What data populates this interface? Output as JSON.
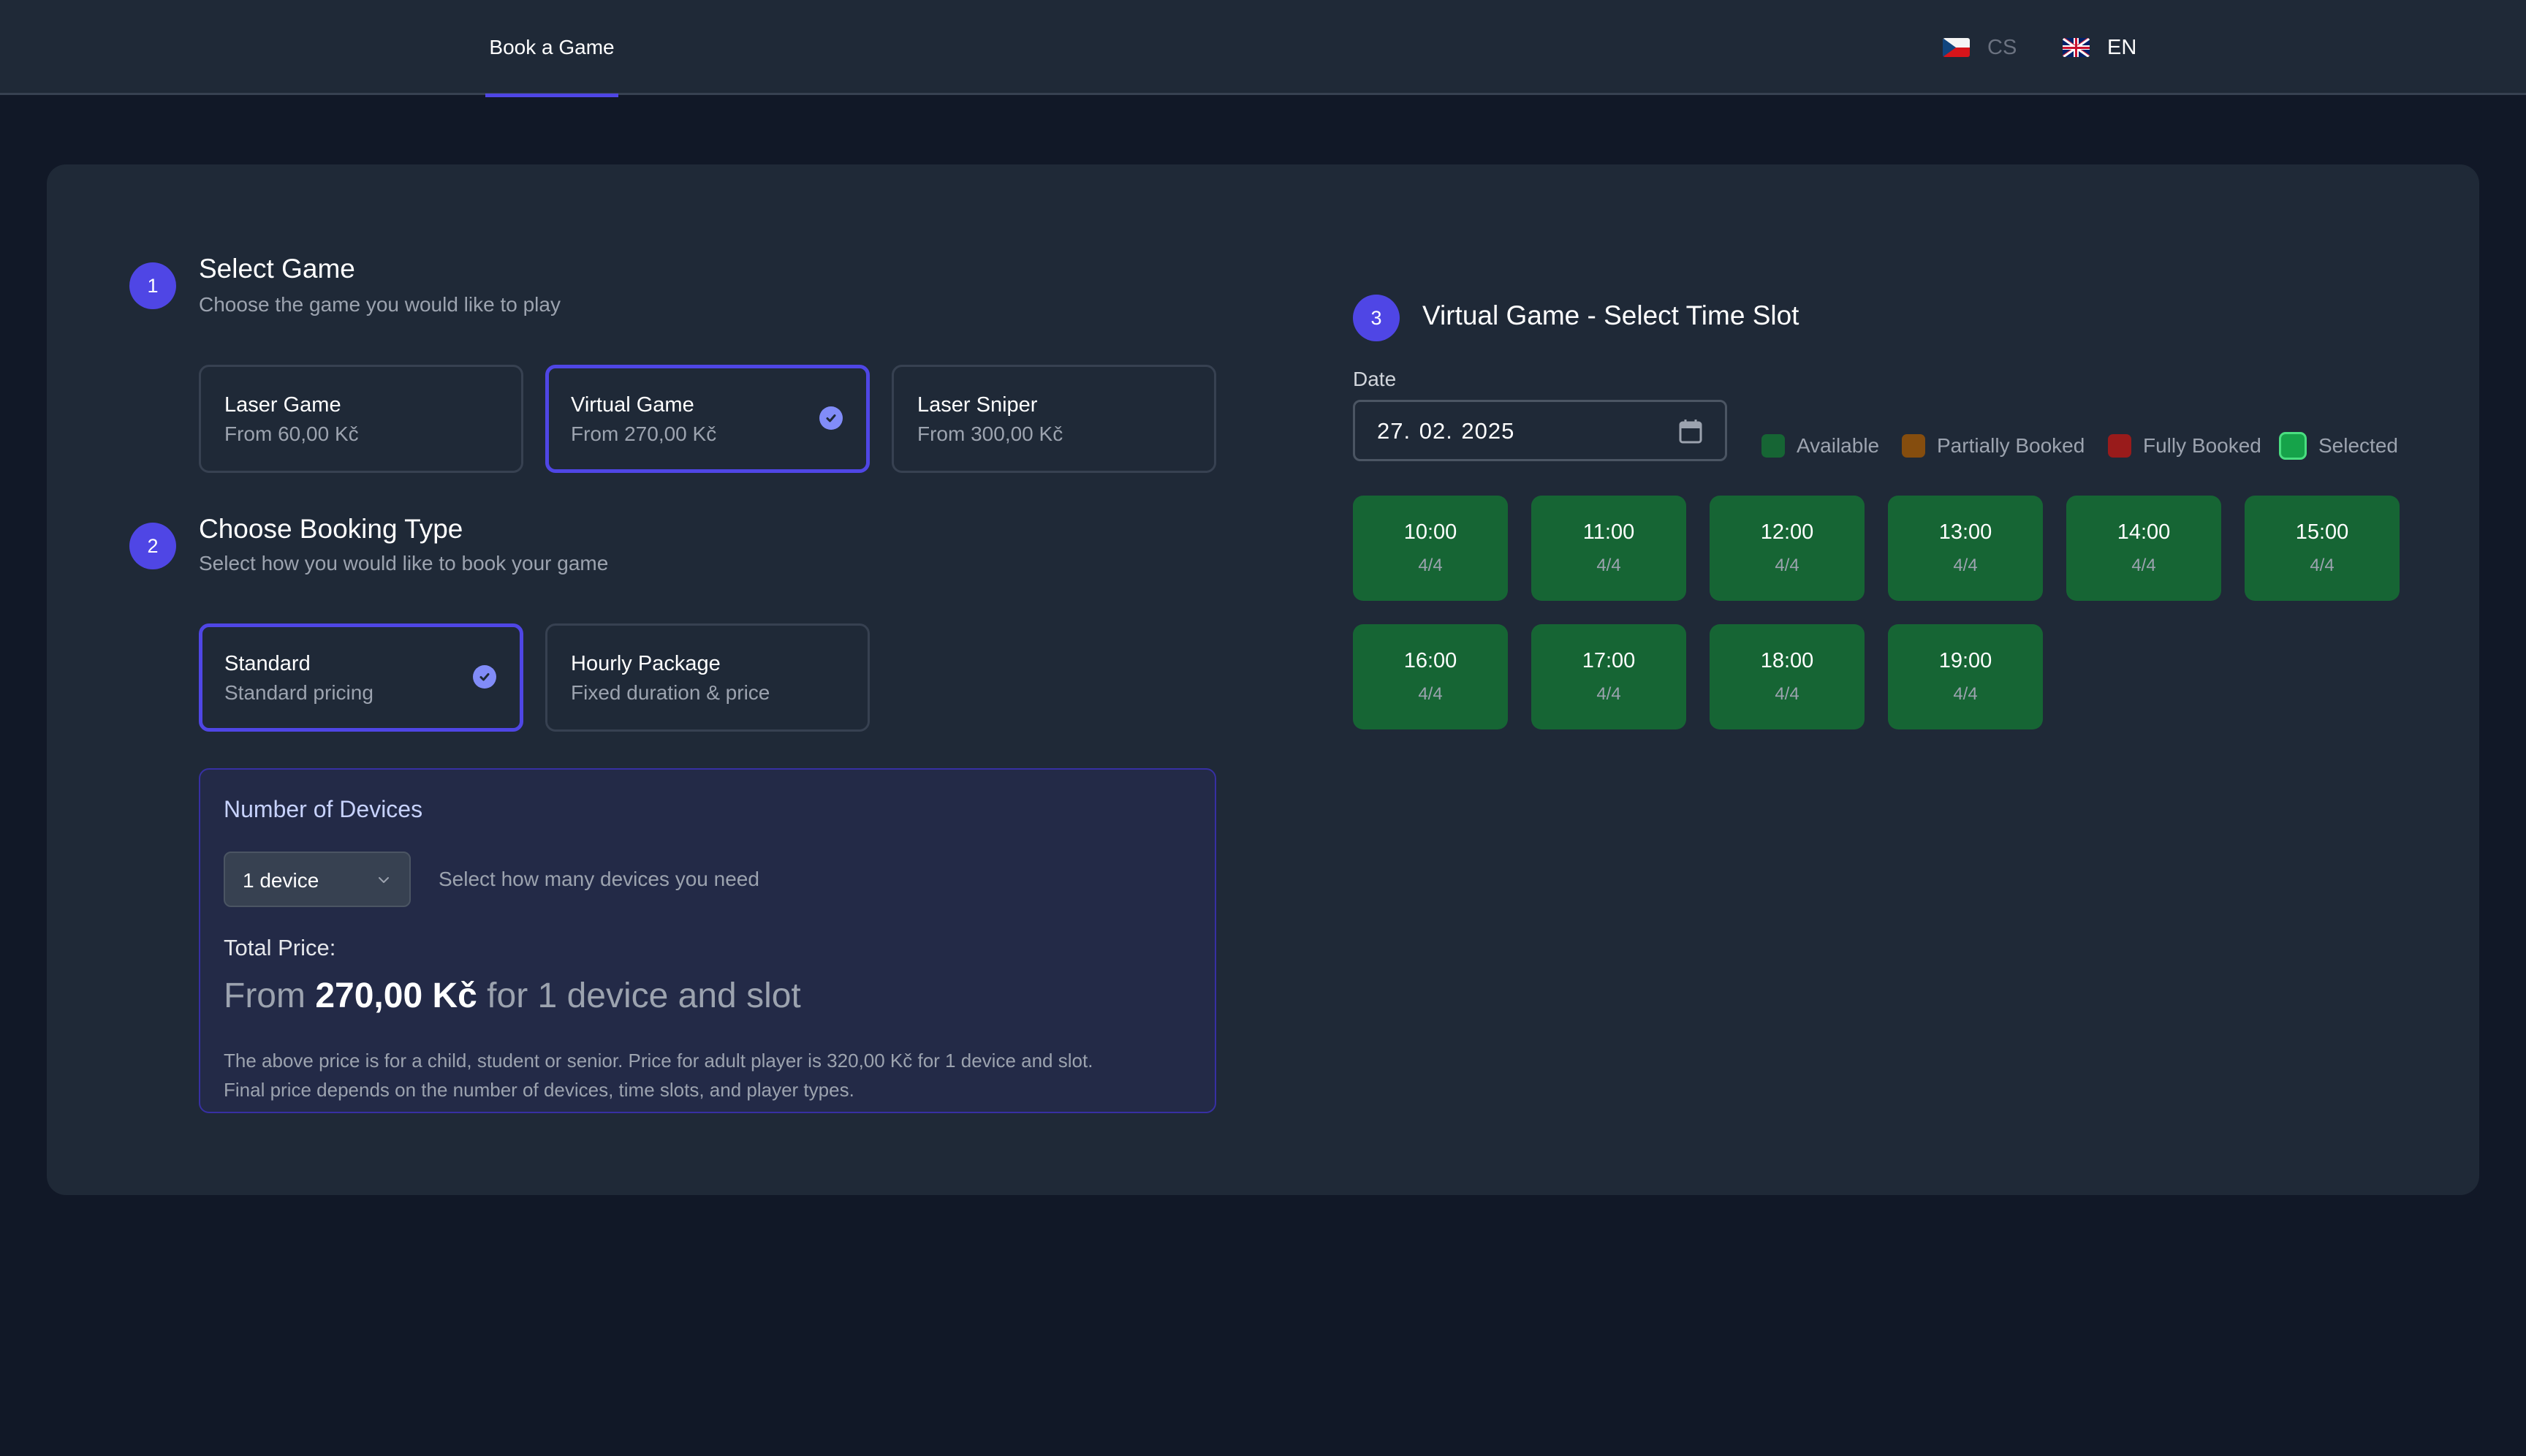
{
  "header": {
    "nav_tab": "Book a Game",
    "languages": [
      {
        "code": "CS",
        "flag": "czech-flag",
        "active": false
      },
      {
        "code": "EN",
        "flag": "uk-flag",
        "active": true
      }
    ]
  },
  "colors": {
    "accent": "#4f46e5",
    "check": "#818cf8",
    "available": "#166534",
    "partially_booked": "#854d0e",
    "fully_booked": "#991b1b",
    "selected": "#16a34a",
    "selected_border": "#4ade80"
  },
  "step1": {
    "number": "1",
    "title": "Select Game",
    "subtitle": "Choose the game you would like to play",
    "options": [
      {
        "title": "Laser Game",
        "subtitle": "From 60,00 Kč",
        "selected": false
      },
      {
        "title": "Virtual Game",
        "subtitle": "From 270,00 Kč",
        "selected": true
      },
      {
        "title": "Laser Sniper",
        "subtitle": "From 300,00 Kč",
        "selected": false
      }
    ]
  },
  "step2": {
    "number": "2",
    "title": "Choose Booking Type",
    "subtitle": "Select how you would like to book your game",
    "options": [
      {
        "title": "Standard",
        "subtitle": "Standard pricing",
        "selected": true
      },
      {
        "title": "Hourly Package",
        "subtitle": "Fixed duration & price",
        "selected": false
      }
    ]
  },
  "devices": {
    "title": "Number of Devices",
    "selected": "1 device",
    "hint": "Select how many devices you need",
    "total_label": "Total Price:",
    "total_prefix": "From ",
    "total_amount": "270,00 Kč",
    "total_suffix": " for 1 device and slot",
    "note_line1": "The above price is for a child, student or senior. Price for adult player is 320,00 Kč for 1 device and slot.",
    "note_line2": "Final price depends on the number of devices, time slots, and player types."
  },
  "step3": {
    "number": "3",
    "title": "Virtual Game - Select Time Slot",
    "date_label": "Date",
    "date_value": "27. 02. 2025",
    "legend": [
      {
        "label": "Available",
        "status": "available"
      },
      {
        "label": "Partially Booked",
        "status": "partially_booked"
      },
      {
        "label": "Fully Booked",
        "status": "fully_booked"
      },
      {
        "label": "Selected",
        "status": "selected"
      }
    ],
    "slots": [
      {
        "time": "10:00",
        "capacity": "4/4",
        "status": "available"
      },
      {
        "time": "11:00",
        "capacity": "4/4",
        "status": "available"
      },
      {
        "time": "12:00",
        "capacity": "4/4",
        "status": "available"
      },
      {
        "time": "13:00",
        "capacity": "4/4",
        "status": "available"
      },
      {
        "time": "14:00",
        "capacity": "4/4",
        "status": "available"
      },
      {
        "time": "15:00",
        "capacity": "4/4",
        "status": "available"
      },
      {
        "time": "16:00",
        "capacity": "4/4",
        "status": "available"
      },
      {
        "time": "17:00",
        "capacity": "4/4",
        "status": "available"
      },
      {
        "time": "18:00",
        "capacity": "4/4",
        "status": "available"
      },
      {
        "time": "19:00",
        "capacity": "4/4",
        "status": "available"
      }
    ]
  }
}
